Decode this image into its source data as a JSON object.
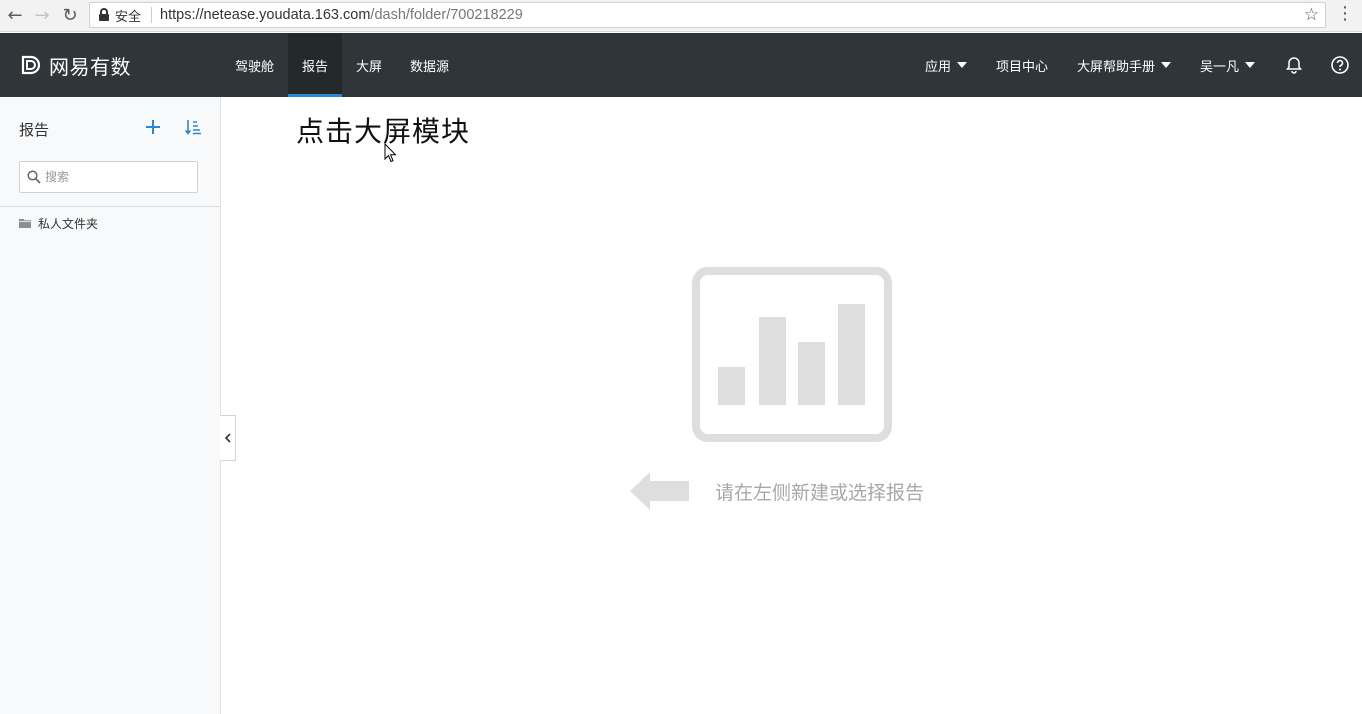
{
  "browser": {
    "secure_label": "安全",
    "url_host": "https://netease.youdata.163.com",
    "url_path": "/dash/folder/700218229"
  },
  "header": {
    "logo_text": "网易有数",
    "nav": [
      {
        "label": "驾驶舱"
      },
      {
        "label": "报告",
        "active": true
      },
      {
        "label": "大屏"
      },
      {
        "label": "数据源"
      }
    ],
    "right": {
      "apps": "应用",
      "project_center": "项目中心",
      "screen_help": "大屏帮助手册",
      "user": "吴一凡"
    },
    "accent_color": "#2b87d3",
    "background_color": "#2f3538"
  },
  "sidebar": {
    "title": "报告",
    "search_placeholder": "搜索",
    "folders": [
      {
        "label": "私人文件夹"
      }
    ]
  },
  "main": {
    "overlay_text": "点击大屏模块",
    "empty_message": "请在左侧新建或选择报告"
  }
}
